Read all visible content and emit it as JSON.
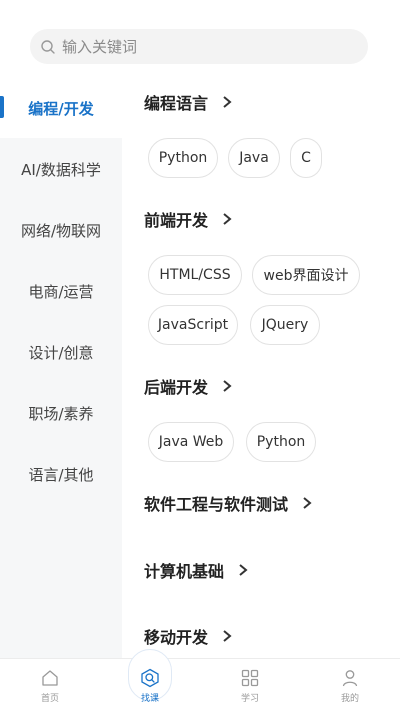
{
  "search": {
    "placeholder": "输入关键词"
  },
  "sidebar": {
    "items": [
      {
        "label": "编程/开发",
        "active": true
      },
      {
        "label": "AI/数据科学"
      },
      {
        "label": "网络/物联网"
      },
      {
        "label": "电商/运营"
      },
      {
        "label": "设计/创意"
      },
      {
        "label": "职场/素养"
      },
      {
        "label": "语言/其他"
      }
    ]
  },
  "sections": [
    {
      "title": "编程语言",
      "chips": [
        "Python",
        "Java",
        "C"
      ]
    },
    {
      "title": "前端开发",
      "chips": [
        "HTML/CSS",
        "web界面设计",
        "JavaScript",
        "JQuery"
      ]
    },
    {
      "title": "后端开发",
      "chips": [
        "Java Web",
        "Python"
      ]
    },
    {
      "title": "软件工程与软件测试",
      "chips": []
    },
    {
      "title": "计算机基础",
      "chips": []
    },
    {
      "title": "移动开发",
      "chips": []
    }
  ],
  "tabbar": {
    "tabs": [
      {
        "label": "首页",
        "icon": "home-icon"
      },
      {
        "label": "找课",
        "icon": "search-icon",
        "active": true
      },
      {
        "label": "学习",
        "icon": "grid-icon"
      },
      {
        "label": "我的",
        "icon": "person-icon"
      }
    ]
  },
  "colors": {
    "accent": "#1a73c8",
    "sidebar_bg": "#f6f7f8"
  }
}
